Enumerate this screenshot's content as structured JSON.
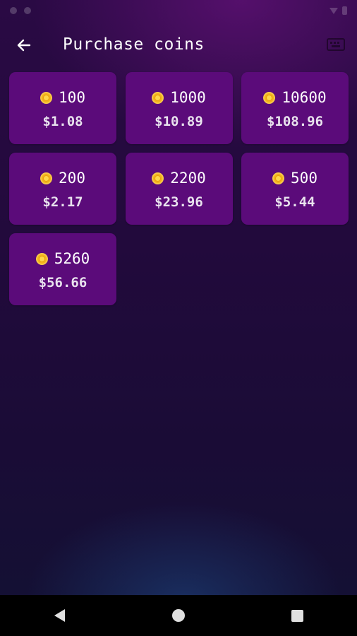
{
  "appbar": {
    "title": "Purchase coins",
    "back_icon": "arrow-left-icon",
    "action_icon": "keyboard-icon"
  },
  "colors": {
    "card_background": "#5b0b7a",
    "coin": "#f3b31a",
    "background_top": "#2a0a44",
    "background_bottom": "#141034"
  },
  "packages": [
    {
      "coins": "100",
      "price": "$1.08"
    },
    {
      "coins": "1000",
      "price": "$10.89"
    },
    {
      "coins": "10600",
      "price": "$108.96"
    },
    {
      "coins": "200",
      "price": "$2.17"
    },
    {
      "coins": "2200",
      "price": "$23.96"
    },
    {
      "coins": "500",
      "price": "$5.44"
    },
    {
      "coins": "5260",
      "price": "$56.66"
    }
  ],
  "navbar": {
    "back_icon": "triangle-back-icon",
    "home_icon": "circle-home-icon",
    "recents_icon": "square-recents-icon"
  }
}
